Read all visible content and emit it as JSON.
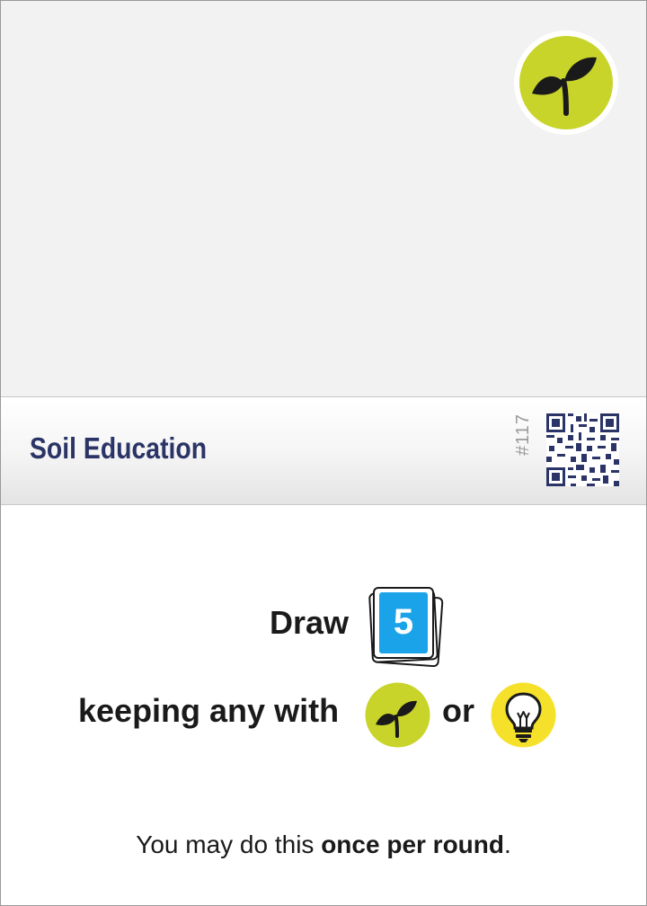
{
  "card": {
    "title": "Soil Education",
    "number": "#117",
    "tag_icon": "sprout-icon",
    "colors": {
      "title": "#2b3466",
      "tag_green": "#c8d42a",
      "bulb_yellow": "#f5e12a",
      "card_blue": "#1aa3e8"
    }
  },
  "ability": {
    "draw_label": "Draw",
    "draw_count": "5",
    "keep_label": "keeping any with",
    "or_label": "or",
    "keep_icons": [
      "sprout-icon",
      "lightbulb-icon"
    ],
    "limit_prefix": "You may do this ",
    "limit_emphasis": "once per round",
    "limit_suffix": "."
  }
}
